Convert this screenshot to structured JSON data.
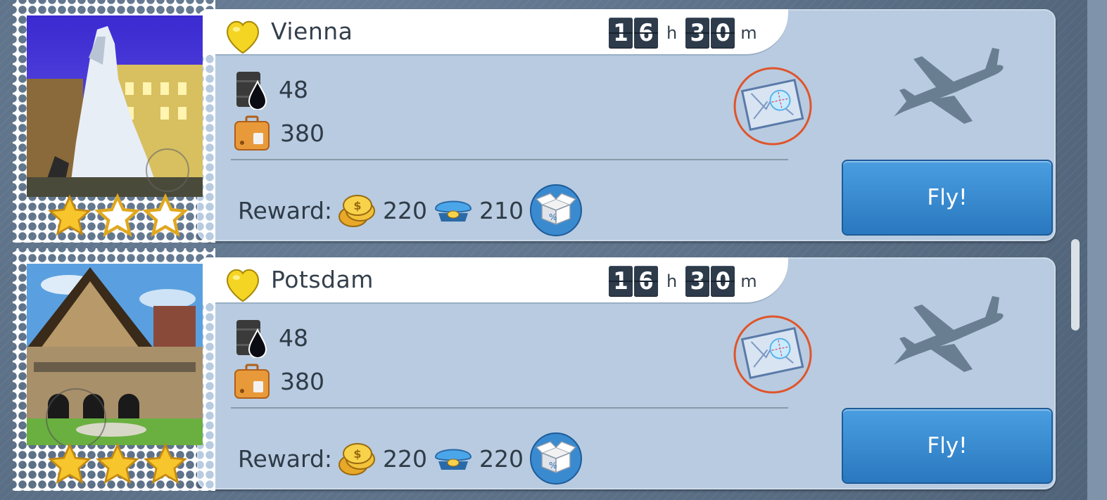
{
  "colors": {
    "card": "#b8cbe0",
    "fly_button": "#2a78c0",
    "digit_bg": "#2d3b4b",
    "map_ring": "#e0542a"
  },
  "destinations": [
    {
      "city": "Vienna",
      "time": {
        "hours": [
          "1",
          "6"
        ],
        "hours_unit": "h",
        "minutes": [
          "3",
          "0"
        ],
        "minutes_unit": "m"
      },
      "fuel": "48",
      "cargo": "380",
      "reward_label": "Reward:",
      "coins": "220",
      "experience": "210",
      "stars_filled": 1,
      "stars_total": 3,
      "fly_label": "Fly!"
    },
    {
      "city": "Potsdam",
      "time": {
        "hours": [
          "1",
          "6"
        ],
        "hours_unit": "h",
        "minutes": [
          "3",
          "0"
        ],
        "minutes_unit": "m"
      },
      "fuel": "48",
      "cargo": "380",
      "reward_label": "Reward:",
      "coins": "220",
      "experience": "220",
      "stars_filled": 3,
      "stars_total": 3,
      "fly_label": "Fly!"
    }
  ]
}
